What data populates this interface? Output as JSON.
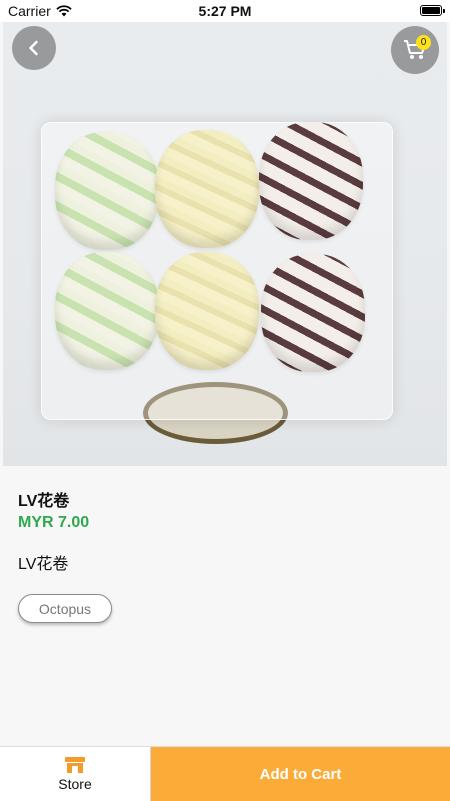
{
  "status_bar": {
    "carrier": "Carrier",
    "time": "5:27 PM"
  },
  "cart": {
    "count": "0"
  },
  "product": {
    "title": "LV花卷",
    "price": "MYR 7.00",
    "description": "LV花卷",
    "tag": "Octopus"
  },
  "footer": {
    "store_label": "Store",
    "add_to_cart_label": "Add to Cart"
  },
  "colors": {
    "accent": "#fbab38",
    "price": "#2fa84f",
    "badge": "#ffe21a"
  }
}
